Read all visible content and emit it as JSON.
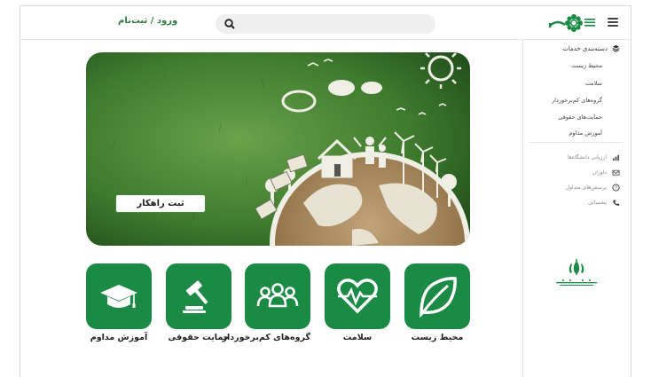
{
  "header": {
    "login_label": "ورود / ثبت‌نام",
    "search_placeholder": ""
  },
  "sidebar": {
    "heading": "دسته‌بندی خدمات",
    "categories": [
      "محیط زیست",
      "سلامت",
      "گروه‌های کم‌برخوردار",
      "حمایت‌های حقوقی",
      "آموزش مداوم"
    ],
    "links": [
      {
        "label": "ارزیابی دانشگاه‌ها",
        "icon": "chart-icon"
      },
      {
        "label": "داوران",
        "icon": "mail-icon"
      },
      {
        "label": "پرسش‌های متداول",
        "icon": "question-icon"
      },
      {
        "label": "پشتیبانی",
        "icon": "phone-icon"
      }
    ]
  },
  "banner": {
    "button_label": "ثبت راهکار"
  },
  "categories": [
    {
      "label": "محیط زیست",
      "icon": "leaf-icon"
    },
    {
      "label": "سلامت",
      "icon": "heart-icon"
    },
    {
      "label": "گروه‌های کم‌برخوردار",
      "icon": "people-icon"
    },
    {
      "label": "حمایت حقوقی",
      "icon": "gavel-icon"
    },
    {
      "label": "آموزش مداوم",
      "icon": "graduation-cap-icon"
    }
  ],
  "colors": {
    "brand_green": "#1a8a45",
    "banner_green": "#3e7a2e"
  }
}
